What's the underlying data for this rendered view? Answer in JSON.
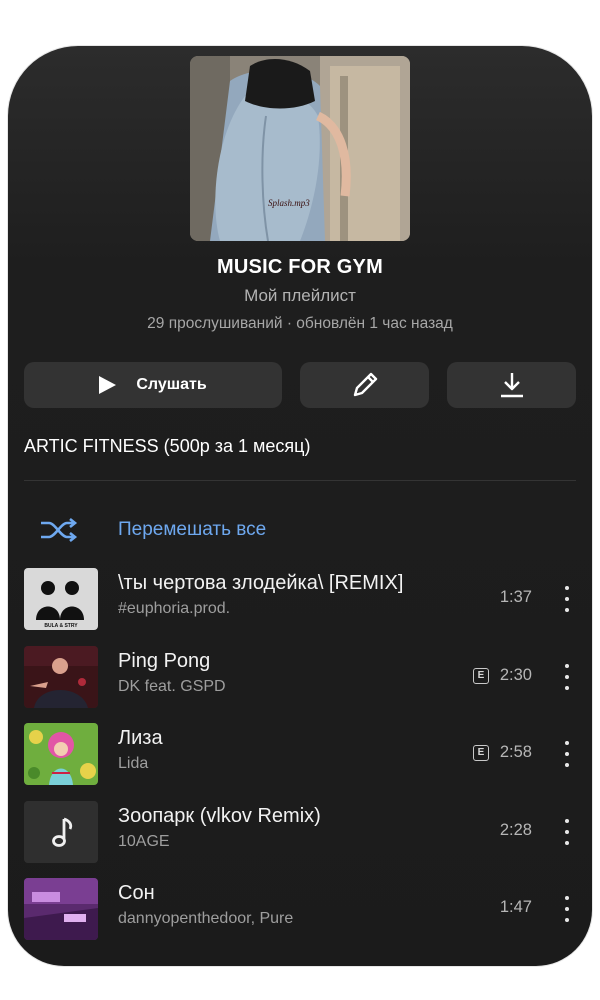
{
  "playlist": {
    "title": "MUSIC FOR GYM",
    "subtitle": "Мой плейлист",
    "stats": "29 прослушиваний · обновлён 1 час назад",
    "cover_watermark": "Splash.mp3"
  },
  "actions": {
    "play_label": "Слушать",
    "edit_icon": "pencil-icon",
    "download_icon": "download-icon"
  },
  "description": "ARTIC FITNESS (500р за 1 месяц)",
  "shuffle": {
    "label": "Перемешать все",
    "icon": "shuffle-icon"
  },
  "tracks": [
    {
      "title": "\\ты чертова злодейка\\ [REMIX]",
      "artist": "#euphoria.prod.",
      "duration": "1:37",
      "explicit": false,
      "thumb_caption": "BULA & STRY"
    },
    {
      "title": "Ping Pong",
      "artist": "DK feat. GSPD",
      "duration": "2:30",
      "explicit": true
    },
    {
      "title": "Лиза",
      "artist": "Lida",
      "duration": "2:58",
      "explicit": true
    },
    {
      "title": "Зоопарк (vlkov Remix)",
      "artist": "10AGE",
      "duration": "2:28",
      "explicit": false
    },
    {
      "title": "Сон",
      "artist": "dannyopenthedoor, Pure",
      "duration": "1:47",
      "explicit": false
    }
  ],
  "explicit_label": "E",
  "colors": {
    "accent": "#6ea8ef",
    "background": "#1b1b1b",
    "button": "#333333"
  }
}
